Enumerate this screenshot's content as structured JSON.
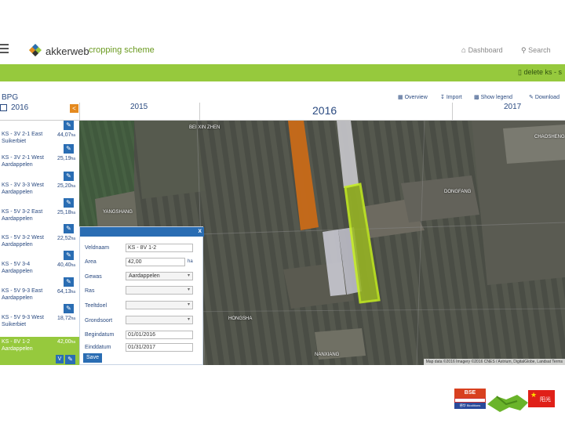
{
  "header": {
    "brand": "akkerweb",
    "subtitle": "cropping scheme",
    "nav": {
      "dashboard": "Dashboard",
      "search": "Search"
    }
  },
  "greenbar": {
    "action_label": "delete ks - s"
  },
  "toolbar": {
    "bpg_label": "BPG",
    "current_year": "2016",
    "overview": "Overview",
    "import": "Import",
    "show_legend": "Show legend",
    "download": "Download"
  },
  "years": {
    "prev": "2015",
    "current": "2016",
    "next": "2017"
  },
  "parcels": [
    {
      "name": "KS - 3V 2-1 East",
      "crop": "Suikerbiet",
      "area": "44,07",
      "unit": "ha"
    },
    {
      "name": "KS - 3V 2-1 West",
      "crop": "Aardappelen",
      "area": "25,19",
      "unit": "ha"
    },
    {
      "name": "KS - 3V 3-3 West",
      "crop": "Aardappelen",
      "area": "25,20",
      "unit": "ha"
    },
    {
      "name": "KS - 5V 3-2 East",
      "crop": "Aardappelen",
      "area": "25,18",
      "unit": "ha"
    },
    {
      "name": "KS - 5V 3-2 West",
      "crop": "Aardappelen",
      "area": "22,52",
      "unit": "ha"
    },
    {
      "name": "KS - 5V 3-4",
      "crop": "Aardappelen",
      "area": "40,40",
      "unit": "ha"
    },
    {
      "name": "KS - 5V 9-3 East",
      "crop": "Aardappelen",
      "area": "64,13",
      "unit": "ha"
    },
    {
      "name": "KS - 5V 9-3 West",
      "crop": "Suikerbiet",
      "area": "18,72",
      "unit": "ha"
    },
    {
      "name": "KS - 8V 1-2",
      "crop": "Aardappelen",
      "area": "42,00",
      "unit": "ha"
    }
  ],
  "selected_parcel_badge": "V",
  "dialog": {
    "close": "x",
    "fields": {
      "veldnaam": {
        "label": "Veldnaam",
        "value": "KS - 8V 1-2"
      },
      "area": {
        "label": "Area",
        "value": "42,00",
        "unit": "ha"
      },
      "gewas": {
        "label": "Gewas",
        "value": "Aardappelen"
      },
      "ras": {
        "label": "Ras",
        "value": ""
      },
      "teeltdoel": {
        "label": "Teeltdoel",
        "value": ""
      },
      "grondsoort": {
        "label": "Grondsoort",
        "value": ""
      },
      "begindatum": {
        "label": "Begindatum",
        "value": "01/01/2016"
      },
      "einddatum": {
        "label": "Einddatum",
        "value": "01/31/2017"
      }
    },
    "save": "Save"
  },
  "map": {
    "labels": [
      "BEI XIN ZHEN",
      "CHAOSHENG",
      "DONGFANG",
      "YANGSHANG",
      "NANXIANG",
      "HONGSHA"
    ],
    "attribution": "Map data ©2016 Imagery ©2016 CNES / Astrium, DigitalGlobe, Landsat   Terms"
  },
  "footer": {
    "logo_text": "BSE",
    "partner_text": "德华 Bioditions",
    "cn_text": "阳光"
  },
  "colors": {
    "accent_green": "#96c93d",
    "primary_blue": "#2a6db3",
    "parcel_orange": "#c86a18",
    "parcel_highlight": "#c6f01e"
  }
}
